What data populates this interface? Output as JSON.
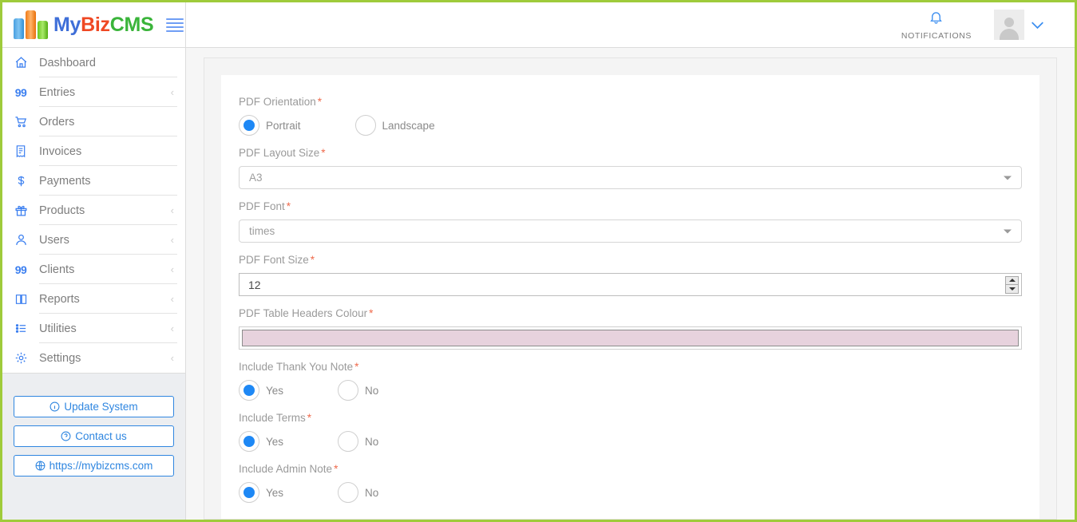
{
  "brand": {
    "name_my": "My",
    "name_biz": "Biz",
    "name_cms": "CMS"
  },
  "header": {
    "notifications_label": "NOTIFICATIONS"
  },
  "sidebar": {
    "items": [
      {
        "label": "Dashboard",
        "icon": "home-icon",
        "caret": ""
      },
      {
        "label": "Entries",
        "icon": "99-icon",
        "caret": "‹"
      },
      {
        "label": "Orders",
        "icon": "cart-icon",
        "caret": ""
      },
      {
        "label": "Invoices",
        "icon": "invoice-icon",
        "caret": ""
      },
      {
        "label": "Payments",
        "icon": "dollar-icon",
        "caret": ""
      },
      {
        "label": "Products",
        "icon": "gift-icon",
        "caret": "‹"
      },
      {
        "label": "Users",
        "icon": "user-icon",
        "caret": "‹"
      },
      {
        "label": "Clients",
        "icon": "99-icon",
        "caret": "‹"
      },
      {
        "label": "Reports",
        "icon": "book-icon",
        "caret": "‹"
      },
      {
        "label": "Utilities",
        "icon": "list-icon",
        "caret": "‹"
      },
      {
        "label": "Settings",
        "icon": "gear-icon",
        "caret": "‹"
      }
    ],
    "buttons": [
      {
        "label": "Update System",
        "icon": "info-icon"
      },
      {
        "label": "Contact us",
        "icon": "question-icon"
      },
      {
        "label": "https://mybizcms.com",
        "icon": "globe-icon"
      }
    ]
  },
  "form": {
    "orientation": {
      "label": "PDF Orientation",
      "required": "*",
      "options": [
        {
          "label": "Portrait",
          "selected": true
        },
        {
          "label": "Landscape",
          "selected": false
        }
      ]
    },
    "layout_size": {
      "label": "PDF Layout Size",
      "required": "*",
      "value": "A3"
    },
    "font": {
      "label": "PDF Font",
      "required": "*",
      "value": "times"
    },
    "font_size": {
      "label": "PDF Font Size",
      "required": "*",
      "value": "12"
    },
    "table_headers_colour": {
      "label": "PDF Table Headers Colour",
      "required": "*",
      "value": "#e7d2dd"
    },
    "thank_you_note": {
      "label": "Include Thank You Note",
      "required": "*",
      "options": [
        {
          "label": "Yes",
          "selected": true
        },
        {
          "label": "No",
          "selected": false
        }
      ]
    },
    "terms": {
      "label": "Include Terms",
      "required": "*",
      "options": [
        {
          "label": "Yes",
          "selected": true
        },
        {
          "label": "No",
          "selected": false
        }
      ]
    },
    "admin_note": {
      "label": "Include Admin Note",
      "required": "*",
      "options": [
        {
          "label": "Yes",
          "selected": true
        },
        {
          "label": "No",
          "selected": false
        }
      ]
    }
  }
}
